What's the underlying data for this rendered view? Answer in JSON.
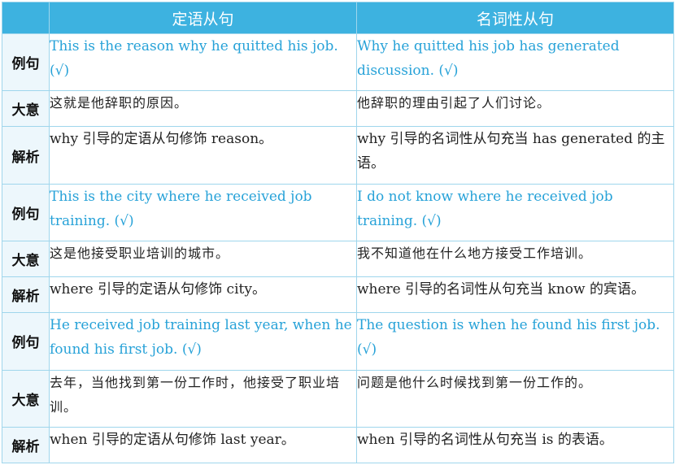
{
  "header": {
    "corner": "",
    "col1": "定语从句",
    "col2": "名词性从句"
  },
  "rows": [
    {
      "label": "例句",
      "left": "This is the reason why he quitted his job. (√)",
      "right": "Why he quitted his job has generated discussion. (√)"
    },
    {
      "label": "大意",
      "left": "这就是他辞职的原因。",
      "right": "他辞职的理由引起了人们讨论。"
    },
    {
      "label": "解析",
      "left": "why 引导的定语从句修饰 reason。",
      "right": "why 引导的名词性从句充当 has generated 的主语。"
    },
    {
      "label": "例句",
      "left": "This is the city where he received job training. (√)",
      "right": "I do not know where he received job training. (√)"
    },
    {
      "label": "大意",
      "left": "这是他接受职业培训的城市。",
      "right": "我不知道他在什么地方接受工作培训。"
    },
    {
      "label": "解析",
      "left": "where 引导的定语从句修饰 city。",
      "right": "where 引导的名词性从句充当 know 的宾语。"
    },
    {
      "label": "例句",
      "left": "He received job training last year, when he found his first job. (√)",
      "right": "The question is when he found his first job.(√)"
    },
    {
      "label": "大意",
      "left": "去年，当他找到第一份工作时，他接受了职业培训。",
      "right": "问题是他什么时候找到第一份工作的。"
    },
    {
      "label": "解析",
      "left": "when 引导的定语从句修饰 last year。",
      "right": "when 引导的名词性从句充当 is 的表语。"
    }
  ]
}
